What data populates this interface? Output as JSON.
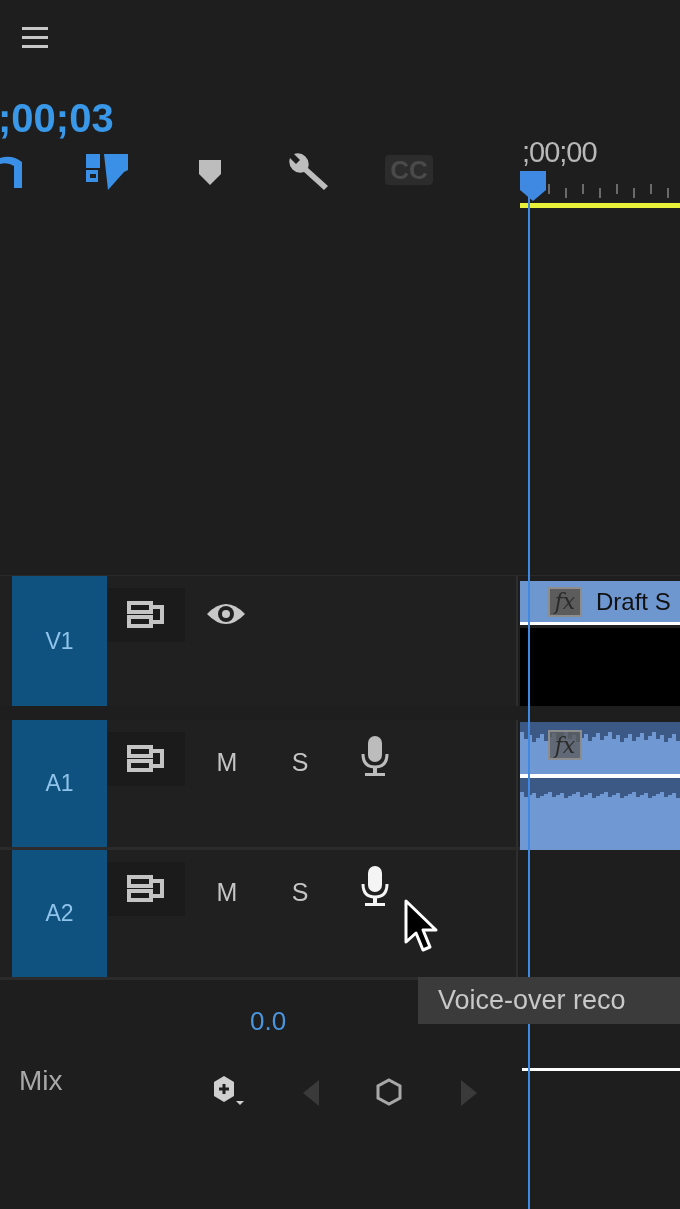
{
  "timecode": ";00;03",
  "tools": [
    {
      "kind": "snap",
      "on": true,
      "disabled": false
    },
    {
      "kind": "linked",
      "on": true,
      "disabled": false
    },
    {
      "kind": "marker",
      "on": false,
      "disabled": false
    },
    {
      "kind": "settings",
      "on": false,
      "disabled": false
    },
    {
      "kind": "captions",
      "label": "CC",
      "on": false,
      "disabled": true
    }
  ],
  "ruler": {
    "timecode": ";00;00"
  },
  "tracks": [
    {
      "name": "V1",
      "kind": "video",
      "clip": {
        "fx_label": "fx",
        "label": "Draft S"
      }
    },
    {
      "name": "A1",
      "kind": "audio",
      "mute_label": "M",
      "solo_label": "S",
      "mic_hovered": false,
      "clip": {
        "fx_label": "fx"
      }
    },
    {
      "name": "A2",
      "kind": "audio",
      "mute_label": "M",
      "solo_label": "S",
      "mic_hovered": true
    }
  ],
  "mix": {
    "value": "0.0",
    "label": "Mix"
  },
  "tooltip": "Voice-over reco"
}
